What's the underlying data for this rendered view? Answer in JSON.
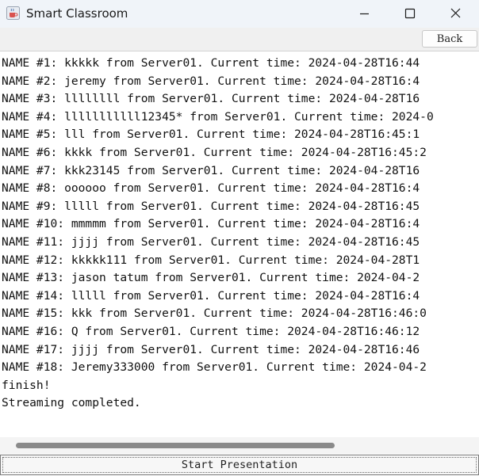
{
  "window": {
    "title": "Smart Classroom",
    "icon": "java-coffee-cup-icon"
  },
  "toolbar": {
    "back_label": "Back"
  },
  "log": {
    "lines": [
      "NAME #1: kkkkk from Server01. Current time: 2024-04-28T16:44",
      "NAME #2: jeremy from Server01. Current time: 2024-04-28T16:4",
      "NAME #3: llllllll from Server01. Current time: 2024-04-28T16",
      "NAME #4: lllllllllll12345* from Server01. Current time: 2024-0",
      "NAME #5: lll from Server01. Current time: 2024-04-28T16:45:1",
      "NAME #6: kkkk from Server01. Current time: 2024-04-28T16:45:2",
      "NAME #7: kkk23145 from Server01. Current time: 2024-04-28T16",
      "NAME #8: oooooo from Server01. Current time: 2024-04-28T16:4",
      "NAME #9: lllll from Server01. Current time: 2024-04-28T16:45",
      "NAME #10: mmmmm from Server01. Current time: 2024-04-28T16:4",
      "NAME #11: jjjj from Server01. Current time: 2024-04-28T16:45",
      "NAME #12: kkkkk111 from Server01. Current time: 2024-04-28T1",
      "NAME #13: jason tatum from Server01. Current time: 2024-04-2",
      "NAME #14: lllll from Server01. Current time: 2024-04-28T16:4",
      "NAME #15: kkk from Server01. Current time: 2024-04-28T16:46:0",
      "NAME #16: Q from Server01. Current time: 2024-04-28T16:46:12",
      "NAME #17: jjjj from Server01. Current time: 2024-04-28T16:46",
      "NAME #18: Jeremy333000 from Server01. Current time: 2024-04-2",
      "finish!",
      "Streaming completed."
    ]
  },
  "bottom": {
    "start_label": "Start Presentation"
  }
}
